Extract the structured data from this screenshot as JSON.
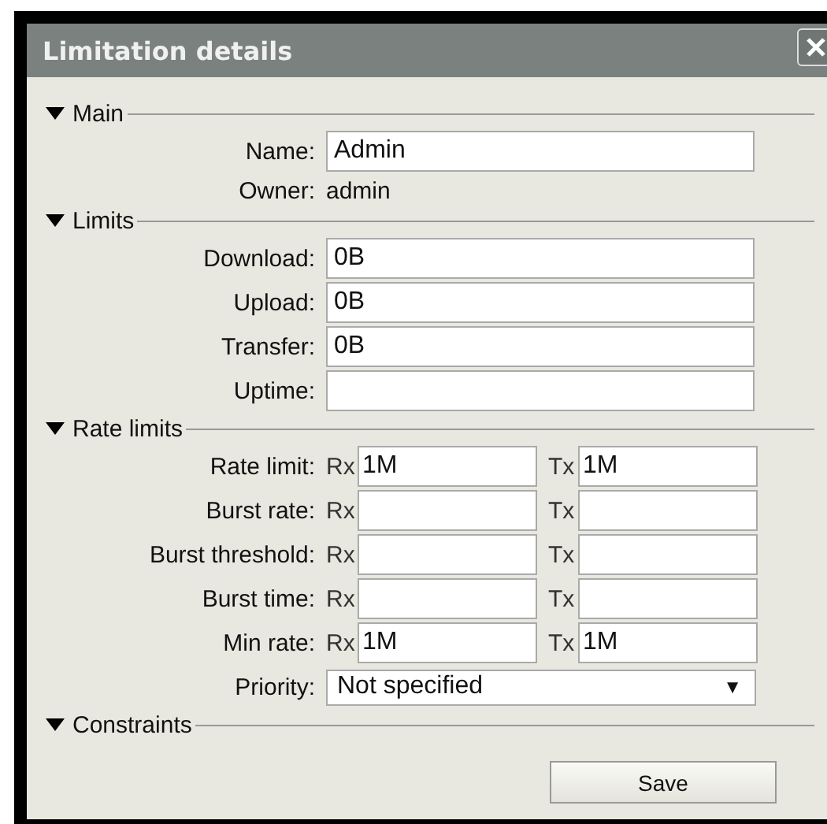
{
  "window": {
    "title": "Limitation details"
  },
  "sections": [
    {
      "title": "Main",
      "expanded": true,
      "rows": [
        {
          "kind": "field",
          "label": "Name:",
          "value": "Admin"
        },
        {
          "kind": "text",
          "label": "Owner:",
          "value": "admin"
        }
      ]
    },
    {
      "title": "Limits",
      "expanded": true,
      "rows": [
        {
          "kind": "field",
          "label": "Download:",
          "value": "0B"
        },
        {
          "kind": "field",
          "label": "Upload:",
          "value": "0B"
        },
        {
          "kind": "field",
          "label": "Transfer:",
          "value": "0B"
        },
        {
          "kind": "field",
          "label": "Uptime:"
        }
      ]
    },
    {
      "title": "Rate limits",
      "expanded": true,
      "rows": [
        {
          "kind": "pair",
          "label": "Rate limit:",
          "rx_label": "Rx",
          "rx_value": "1M",
          "tx_label": "Tx",
          "tx_value": "1M"
        },
        {
          "kind": "pair",
          "label": "Burst rate:",
          "rx_label": "Rx",
          "tx_label": "Tx"
        },
        {
          "kind": "pair",
          "label": "Burst threshold:",
          "rx_label": "Rx",
          "tx_label": "Tx"
        },
        {
          "kind": "pair",
          "label": "Burst time:",
          "rx_label": "Rx",
          "tx_label": "Tx"
        },
        {
          "kind": "pair",
          "label": "Min rate:",
          "rx_label": "Rx",
          "rx_value": "1M",
          "tx_label": "Tx",
          "tx_value": "1M"
        },
        {
          "kind": "select",
          "label": "Priority:",
          "value": "Not specified",
          "arrow": "▼"
        }
      ]
    },
    {
      "title": "Constraints",
      "expanded": true
    }
  ],
  "buttons": [
    {
      "label": "Save"
    }
  ]
}
